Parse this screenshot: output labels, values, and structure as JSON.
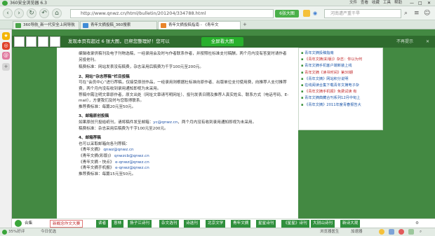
{
  "window": {
    "title": "360安全浏览器 6.3",
    "menus": [
      "文件",
      "查看",
      "收藏",
      "工具",
      "帮助"
    ]
  },
  "toolbar": {
    "url": "http://www.qnwz.cn/html/bulletin/201204/334788.html",
    "zoom_label": "6张大图",
    "search_placeholder": "河南遭严重干旱"
  },
  "tabs": [
    {
      "label": "360导航_新一代安全上网导航",
      "color": "#4aa54a"
    },
    {
      "label": "青年文摘投稿_360搜索",
      "color": "#3f8cd6"
    },
    {
      "label": "青年文摘投稿指南 - 《青年文",
      "color": "#e8852a"
    }
  ],
  "notification": {
    "message": "发现本页有超过 6 张大图，已帮您整理好！您可以",
    "button": "全屏看大图",
    "close": "不再提示"
  },
  "article": {
    "intro": "编辑收录供稿刊及电子刊物选稿，一经录用会及时与作者联系作者，并按照杜标准支付稿酬，两个月内没有答复时请作者另投他刊。",
    "rate1": "稿费标准：网站发表没有稿费，杂志采用后稿费为千字100元至200元。",
    "h2": "2、网站“杂志荐稿”栏目投稿",
    "p2": "可在“会员中心”进行荐稿，仅接受原创作品，一经录用则根据杜标准向原作者、出版单位支付使用费，向推荐人支付推荐费，两个月内没有收到录用通知即视为未采用。",
    "p2b": "荐稿中需注明文章原作者，原文出处（网址文章请写明网址）、投刊发表日期及推荐人真实姓名、联系方式（电话号码、E-mail），方便我们及时与您取得联系。",
    "rate2": "推荐费标准：每篇20元至50元。",
    "h3": "3、邮箱原创投稿",
    "p3a": "如果原创只投给纸刊，请将稿件发至邮箱：",
    "p3email": "yc@qnwz.cn",
    "p3b": "，两个月内没有收到录用通知即视为未采用。",
    "rate3": "稿费标准：杂志采用后稿费为千字100元至200元。",
    "h4": "4、邮箱荐稿",
    "p4": "也可以采取邮箱向各刊荐稿：",
    "emails": [
      {
        "name": "《青年文摘》",
        "addr": "qnwz@qnwz.cn"
      },
      {
        "name": "《青年文摘(彩版)》",
        "addr": "qnwzcb@qnwz.cn"
      },
      {
        "name": "《青年文摘・快点》",
        "addr": "e-qnwz@qnwz.cn"
      },
      {
        "name": "《青年文摘手机报》",
        "addr": "e-qnwz@qnwz.cn"
      }
    ],
    "rate4": "推荐费标准：每篇15元至50元。"
  },
  "right_list": [
    {
      "text": "青年文摘投稿指南",
      "c": "b"
    },
    {
      "text": "《青年文摘(彩版)》杂志：你以为何",
      "c": "r"
    },
    {
      "text": "青年文摘手机客户端新装上线",
      "c": "b"
    },
    {
      "text": "青年文摘《读书时间》第30期",
      "c": "r"
    },
    {
      "text": "《青年文摘》网站积分说明",
      "c": "b"
    },
    {
      "text": "在线阅读合集下载青年文摘电子杂",
      "c": "b"
    },
    {
      "text": "《青年文摘手机报》免费试读 有",
      "c": "r"
    },
    {
      "text": "青年文摘典藏合刊系列12月中旬上",
      "c": "b"
    },
    {
      "text": "《青年文摘》2011年度青春报告大",
      "c": "b"
    }
  ],
  "bottom_links": [
    "新概念作文大赛",
    "读者",
    "意林",
    "扬子江诗刊",
    "杂文选刊",
    "诗选刊",
    "北京文学",
    "青年文摘",
    "星星诗刊",
    "《星星》诗刊",
    "大别山诗刊",
    "新诗大观"
  ],
  "bottom_left": "合集",
  "status": {
    "left": "35%好评",
    "middle": "今日优选",
    "right": "浏览器医生",
    "speed": "加速器"
  },
  "colors": {
    "page_green": "#438942",
    "button_green": "#28b02c"
  }
}
